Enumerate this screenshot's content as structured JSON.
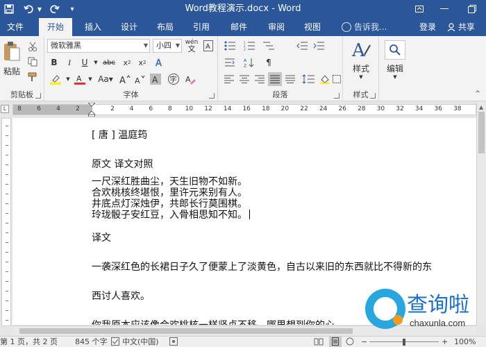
{
  "window": {
    "title": "Word教程演示.docx - Word"
  },
  "tabs": [
    {
      "label": "文件"
    },
    {
      "label": "开始"
    },
    {
      "label": "插入"
    },
    {
      "label": "设计"
    },
    {
      "label": "布局"
    },
    {
      "label": "引用"
    },
    {
      "label": "邮件"
    },
    {
      "label": "审阅"
    },
    {
      "label": "视图"
    }
  ],
  "header": {
    "tell_me_placeholder": "告诉我...",
    "signin": "登录",
    "share": "共享"
  },
  "ribbon": {
    "clipboard": {
      "paste": "粘贴",
      "label": "剪贴板"
    },
    "font": {
      "name": "微软雅黑",
      "size": "小四",
      "label": "字体"
    },
    "paragraph": {
      "label": "段落"
    },
    "styles": {
      "button": "样式",
      "label": "样式"
    },
    "editing": {
      "button": "编辑"
    }
  },
  "ruler": {
    "numbers": [
      "8",
      "6",
      "4",
      "2",
      "2",
      "4",
      "6",
      "8",
      "10",
      "12",
      "14",
      "16",
      "18",
      "20",
      "22",
      "24",
      "26",
      "28",
      "30",
      "32",
      "34",
      "36",
      "38"
    ]
  },
  "document": {
    "author": "[ 唐 ] 温庭筠",
    "heading": "原文 译文对照",
    "poem": [
      "一尺深红胜曲尘，天生旧物不如新。",
      "合欢桃核终堪恨，里许元来别有人。",
      "井底点灯深烛伊，共郎长行莫围棋。",
      "玲珑骰子安红豆，入骨相思知不知。"
    ],
    "translation_heading": "译文",
    "translation_1": "一袭深红色的长裙日子久了便蒙上了淡黄色，自古以来旧的东西就比不得新的东",
    "translation_2": "西讨人喜欢。",
    "translation_3": "你我原本应该像合欢桃核一样坚贞不移，哪里想到你的心"
  },
  "status": {
    "page": "第 1 页，共 2 页",
    "words": "845 个字",
    "language": "中文(中国)",
    "zoom": "100%"
  },
  "watermark": {
    "cn": "查询啦",
    "en": "chaxunla.com"
  },
  "colors": {
    "brand": "#2b579a",
    "ribbon_bg": "#f3f3f3"
  }
}
